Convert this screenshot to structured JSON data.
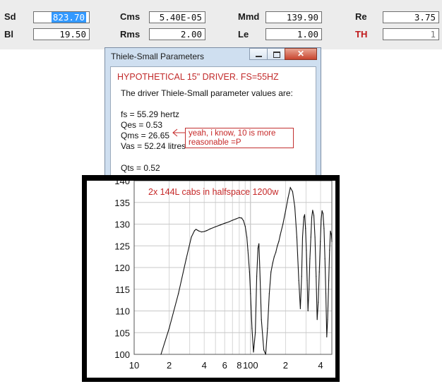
{
  "params": {
    "sd": {
      "label": "Sd",
      "value": "823.70"
    },
    "bl": {
      "label": "Bl",
      "value": "19.50"
    },
    "cms": {
      "label": "Cms",
      "value": "5.40E-05"
    },
    "rms": {
      "label": "Rms",
      "value": "2.00"
    },
    "mmd": {
      "label": "Mmd",
      "value": "139.90"
    },
    "le": {
      "label": "Le",
      "value": "1.00"
    },
    "re": {
      "label": "Re",
      "value": "3.75"
    },
    "th": {
      "label": "TH",
      "value": "1"
    }
  },
  "dialog": {
    "title": "Thiele-Small Parameters",
    "close_glyph": "✕",
    "heading": "HYPOTHETICAL 15\" DRIVER.  FS=55HZ",
    "intro": "The driver Thiele-Small parameter values are:",
    "lines": {
      "fs": "fs = 55.29 hertz",
      "qes": "Qes = 0.53",
      "qms": "Qms = 26.65",
      "vas": "Vas = 52.24 litres",
      "qts": "Qts = 0.52"
    }
  },
  "annotation": {
    "line1": "yeah, i know, 10 is more",
    "line2": "reasonable =P"
  },
  "colors": {
    "accent_red": "#c62828",
    "selection_blue": "#3399ff"
  },
  "chart_data": {
    "type": "line",
    "annotation": "2x 144L cabs in halfspace 1200w",
    "x_scale": "log",
    "xlim": [
      10,
      500
    ],
    "ylim": [
      100,
      140
    ],
    "grid": true,
    "y_ticks": [
      "140",
      "135",
      "130",
      "125",
      "120",
      "115",
      "110",
      "105",
      "100"
    ],
    "y_tick_values": [
      140,
      135,
      130,
      125,
      120,
      115,
      110,
      105,
      100
    ],
    "x_ticks": [
      "10",
      "2",
      "4",
      "6",
      "8",
      "100",
      "2",
      "4"
    ],
    "x_tick_values": [
      10,
      20,
      40,
      60,
      80,
      100,
      200,
      400
    ],
    "series": [
      {
        "x": [
          17,
          20,
          24,
          28,
          31,
          33,
          34,
          35,
          36,
          38,
          40,
          42,
          45,
          50,
          55,
          60,
          65,
          70,
          75,
          80,
          84,
          87,
          90,
          93,
          95,
          98,
          100,
          103,
          106,
          110,
          113,
          116,
          118,
          120,
          124,
          130,
          135,
          140,
          145,
          150,
          155,
          160,
          165,
          170,
          175,
          180,
          190,
          200,
          210,
          220,
          230,
          240,
          250,
          260,
          268,
          275,
          280,
          287,
          292,
          297,
          302,
          307,
          312,
          318,
          324,
          330,
          336,
          342,
          350,
          358,
          366,
          374,
          382,
          390,
          398,
          405,
          412,
          420,
          428,
          436,
          444,
          452,
          460,
          470,
          478,
          486,
          495,
          500
        ],
        "y": [
          100,
          106,
          114,
          122,
          127,
          128.5,
          128.8,
          128.6,
          128.4,
          128.2,
          128.3,
          128.5,
          128.9,
          129.4,
          129.8,
          130.2,
          130.5,
          130.9,
          131.2,
          131.5,
          131.4,
          130.8,
          129.5,
          127,
          124,
          119,
          114,
          106,
          100.5,
          105,
          118,
          124.5,
          125.5,
          120,
          108,
          101,
          100,
          106,
          114,
          119,
          121,
          122.5,
          123.5,
          125,
          126,
          127.5,
          130,
          133,
          136,
          138.4,
          137.5,
          134,
          127,
          117,
          110.5,
          118,
          127,
          131.6,
          132.2,
          129,
          124,
          117,
          110,
          115,
          122,
          127,
          131.5,
          133.2,
          132,
          127,
          118,
          108,
          112,
          119,
          126,
          131,
          133.1,
          132.4,
          129,
          122,
          114,
          104,
          108,
          117,
          124,
          128.4,
          127.6,
          126
        ]
      }
    ]
  }
}
